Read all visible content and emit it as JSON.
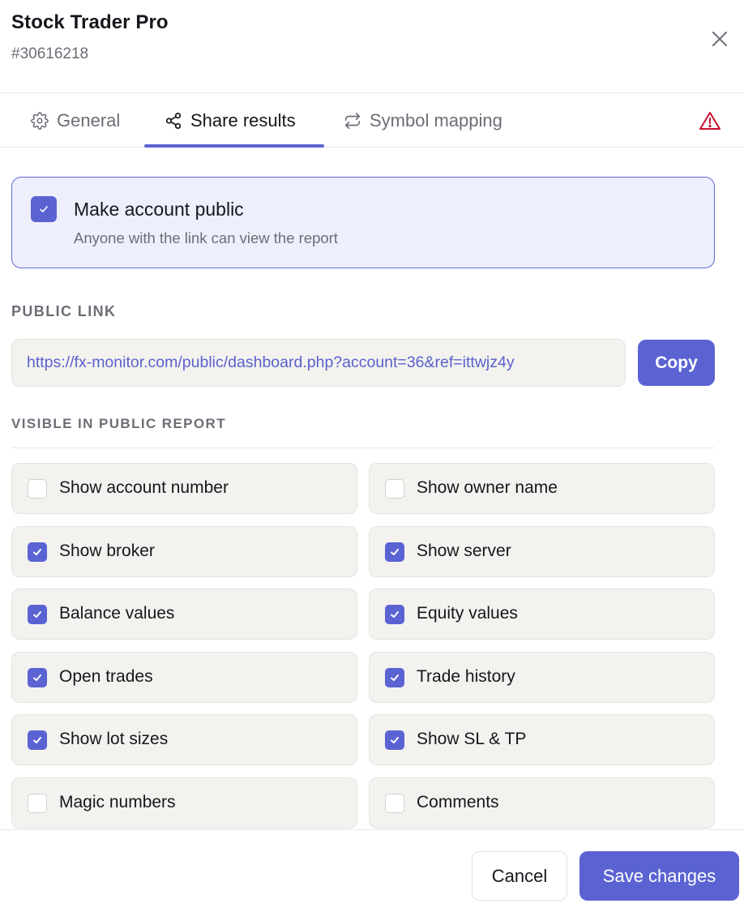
{
  "header": {
    "title": "Stock Trader Pro",
    "account_id": "#30616218"
  },
  "tabs": [
    {
      "label": "General",
      "icon": "gear-icon",
      "active": false
    },
    {
      "label": "Share results",
      "icon": "share-icon",
      "active": true
    },
    {
      "label": "Symbol mapping",
      "icon": "repeat-icon",
      "active": false
    }
  ],
  "public_toggle": {
    "title": "Make account public",
    "description": "Anyone with the link can view the report",
    "checked": true
  },
  "public_link": {
    "section_label": "PUBLIC LINK",
    "url": "https://fx-monitor.com/public/dashboard.php?account=36&ref=ittwjz4y",
    "copy_label": "Copy"
  },
  "visibility": {
    "section_label": "VISIBLE IN PUBLIC REPORT",
    "options": [
      {
        "label": "Show account number",
        "checked": false
      },
      {
        "label": "Show owner name",
        "checked": false
      },
      {
        "label": "Show broker",
        "checked": true
      },
      {
        "label": "Show server",
        "checked": true
      },
      {
        "label": "Balance values",
        "checked": true
      },
      {
        "label": "Equity values",
        "checked": true
      },
      {
        "label": "Open trades",
        "checked": true
      },
      {
        "label": "Trade history",
        "checked": true
      },
      {
        "label": "Show lot sizes",
        "checked": true
      },
      {
        "label": "Show SL & TP",
        "checked": true
      },
      {
        "label": "Magic numbers",
        "checked": false
      },
      {
        "label": "Comments",
        "checked": false
      }
    ]
  },
  "footer": {
    "cancel_label": "Cancel",
    "save_label": "Save changes"
  },
  "colors": {
    "accent": "#5b63d3",
    "warning": "#c8102e",
    "card_bg": "#f3f2ef",
    "public_card_bg": "#eeeffc"
  }
}
